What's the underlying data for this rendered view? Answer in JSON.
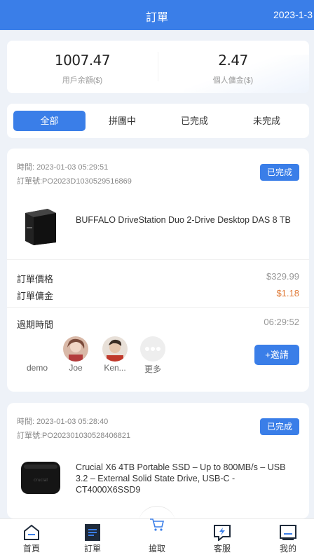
{
  "header": {
    "title": "訂單",
    "date": "2023-1-3"
  },
  "balance": {
    "user_amount": "1007.47",
    "user_label": "用戶余額($)",
    "commission_amount": "2.47",
    "commission_label": "個人傭金($)"
  },
  "tabs": [
    {
      "label": "全部",
      "active": true
    },
    {
      "label": "拼團中",
      "active": false
    },
    {
      "label": "已完成",
      "active": false
    },
    {
      "label": "未完成",
      "active": false
    }
  ],
  "orders": [
    {
      "time": "時間: 2023-01-03 05:29:51",
      "order_no": "訂單號:PO2023D1030529516869",
      "status": "已完成",
      "product_name": "BUFFALO DriveStation Duo 2-Drive Desktop DAS 8 TB",
      "price_label": "訂單價格",
      "price": "$329.99",
      "commission_label": "訂單傭金",
      "commission": "$1.18",
      "expiry_label": "過期時間",
      "expiry": "06:29:52",
      "members": [
        {
          "name": "demo",
          "avatar": "default"
        },
        {
          "name": "Joe",
          "avatar": "girl"
        },
        {
          "name": "Ken...",
          "avatar": "boy"
        },
        {
          "name": "更多",
          "avatar": "more"
        }
      ],
      "invite_label": "+邀請"
    },
    {
      "time": "時間: 2023-01-03 05:28:40",
      "order_no": "訂單號:PO202301030528406821",
      "status": "已完成",
      "product_name": "Crucial X6 4TB Portable SSD – Up to 800MB/s – USB 3.2 – External Solid State Drive, USB-C - CT4000X6SSD9"
    }
  ],
  "nav": [
    {
      "label": "首頁",
      "icon": "home-icon"
    },
    {
      "label": "訂單",
      "icon": "orders-icon"
    },
    {
      "label": "搶取",
      "icon": "cart-icon"
    },
    {
      "label": "客服",
      "icon": "support-icon"
    },
    {
      "label": "我的",
      "icon": "profile-icon"
    }
  ],
  "colors": {
    "primary": "#3a7ee8",
    "commission": "#e07b39",
    "background": "#eef2f8"
  }
}
